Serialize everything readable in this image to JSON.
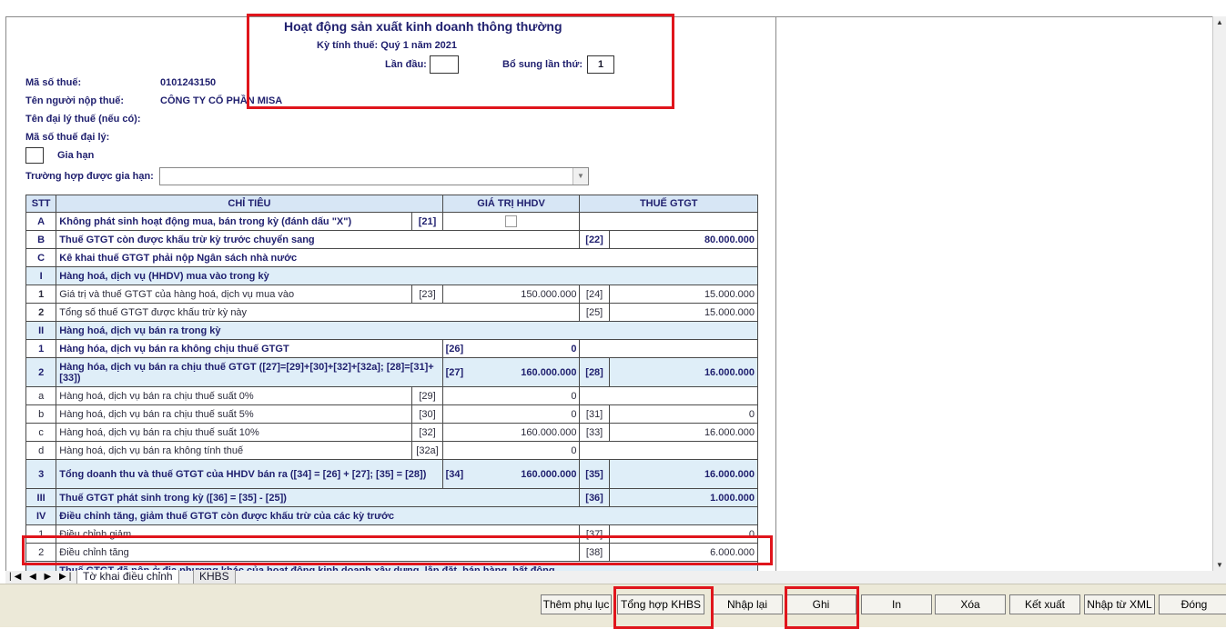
{
  "header": {
    "title": "Hoạt động sản xuất kinh doanh thông thường",
    "period": "Kỳ tính thuế: Quý 1 năm 2021",
    "first_time_label": "Lần đầu:",
    "first_time_value": "",
    "supplement_label": "Bổ sung lần thứ:",
    "supplement_value": "1"
  },
  "info": {
    "tax_code_label": "Mã số thuế:",
    "tax_code_value": "0101243150",
    "taxpayer_label": "Tên người nộp thuế:",
    "taxpayer_value": "CÔNG TY CỔ PHẦN MISA",
    "agent_name_label": "Tên đại lý thuế (nếu có):",
    "agent_code_label": "Mã số thuế đại lý:",
    "extension_label": "Gia hạn",
    "extension_case_label": "Trường hợp được gia hạn:",
    "extension_case_value": ""
  },
  "table": {
    "headers": [
      "STT",
      "CHỈ TIÊU",
      "GIÁ TRỊ HHDV",
      "THUẾ GTGT"
    ],
    "rows": [
      {
        "stt": "A",
        "label": "Không phát sinh hoạt động mua, bán trong kỳ (đánh dấu \"X\")",
        "c1": "[21]",
        "v1": "",
        "c2": "",
        "v2": ""
      },
      {
        "stt": "B",
        "label": "Thuế GTGT còn được khấu trừ kỳ trước chuyển sang",
        "c1": "",
        "v1": "",
        "c2": "[22]",
        "v2": "80.000.000"
      },
      {
        "stt": "C",
        "label": "Kê khai thuế GTGT phải nộp Ngân sách nhà nước",
        "c1": "",
        "v1": "",
        "c2": "",
        "v2": ""
      },
      {
        "stt": "I",
        "label": "Hàng hoá, dịch vụ (HHDV) mua vào trong kỳ",
        "c1": "",
        "v1": "",
        "c2": "",
        "v2": ""
      },
      {
        "stt": "1",
        "label": "Giá trị và thuế GTGT của hàng hoá, dịch vụ mua vào",
        "c1": "[23]",
        "v1": "150.000.000",
        "c2": "[24]",
        "v2": "15.000.000"
      },
      {
        "stt": "2",
        "label": "Tổng số thuế GTGT được khấu trừ kỳ này",
        "c1": "",
        "v1": "",
        "c2": "[25]",
        "v2": "15.000.000"
      },
      {
        "stt": "II",
        "label": "Hàng hoá, dịch vụ bán ra trong kỳ",
        "c1": "",
        "v1": "",
        "c2": "",
        "v2": ""
      },
      {
        "stt": "1",
        "label": "Hàng hóa, dịch vụ bán ra không chịu thuế GTGT",
        "c1": "[26]",
        "v1": "0",
        "c2": "",
        "v2": ""
      },
      {
        "stt": "2",
        "label": "Hàng hóa, dịch vụ bán ra chịu thuế GTGT ([27]=[29]+[30]+[32]+[32a]; [28]=[31]+[33])",
        "c1": "[27]",
        "v1": "160.000.000",
        "c2": "[28]",
        "v2": "16.000.000"
      },
      {
        "stt": "a",
        "label": "Hàng hoá, dịch vụ bán ra chịu thuế suất 0%",
        "c1": "[29]",
        "v1": "0",
        "c2": "",
        "v2": ""
      },
      {
        "stt": "b",
        "label": "Hàng hoá, dịch vụ bán ra chịu thuế suất 5%",
        "c1": "[30]",
        "v1": "0",
        "c2": "[31]",
        "v2": "0"
      },
      {
        "stt": "c",
        "label": "Hàng hoá, dịch vụ bán ra chịu thuế suất 10%",
        "c1": "[32]",
        "v1": "160.000.000",
        "c2": "[33]",
        "v2": "16.000.000"
      },
      {
        "stt": "d",
        "label": "Hàng hoá, dịch vụ bán ra không tính thuế",
        "c1": "[32a]",
        "v1": "0",
        "c2": "",
        "v2": ""
      },
      {
        "stt": "3",
        "label": "Tổng doanh thu và thuế GTGT của HHDV bán ra ([34] = [26] + [27]; [35] = [28])",
        "c1": "[34]",
        "v1": "160.000.000",
        "c2": "[35]",
        "v2": "16.000.000"
      },
      {
        "stt": "III",
        "label": "Thuế GTGT phát sinh trong kỳ ([36] = [35] - [25])",
        "c1": "",
        "v1": "",
        "c2": "[36]",
        "v2": "1.000.000"
      },
      {
        "stt": "IV",
        "label": "Điều chỉnh tăng, giảm thuế GTGT còn được khấu trừ của các kỳ trước",
        "c1": "",
        "v1": "",
        "c2": "",
        "v2": ""
      },
      {
        "stt": "1",
        "label": "Điều chỉnh giảm",
        "c1": "",
        "v1": "",
        "c2": "[37]",
        "v2": "0"
      },
      {
        "stt": "2",
        "label": "Điều chỉnh tăng",
        "c1": "",
        "v1": "",
        "c2": "[38]",
        "v2": "6.000.000"
      },
      {
        "stt": "",
        "label": "Thuế GTGT đã nộp ở địa phương khác của hoạt động kinh doanh xây dựng, lắp đặt, bán hàng, bất động",
        "c1": "",
        "v1": "",
        "c2": "",
        "v2": ""
      }
    ]
  },
  "tabs": {
    "nav": "|◀ ◀ ▶ ▶|",
    "active": "Tờ khai điều chỉnh",
    "other": "KHBS"
  },
  "buttons": {
    "add_appendix": "Thêm phụ lục",
    "summary_khbs": "Tổng hợp KHBS",
    "reenter": "Nhập lại",
    "save": "Ghi",
    "print": "In",
    "delete": "Xóa",
    "export": "Kết xuất",
    "import_xml": "Nhập từ XML",
    "close": "Đóng"
  },
  "colors": {
    "highlight": "#e0151c",
    "header_bg": "#d7e6f5",
    "text_navy": "#1f1f6e"
  }
}
